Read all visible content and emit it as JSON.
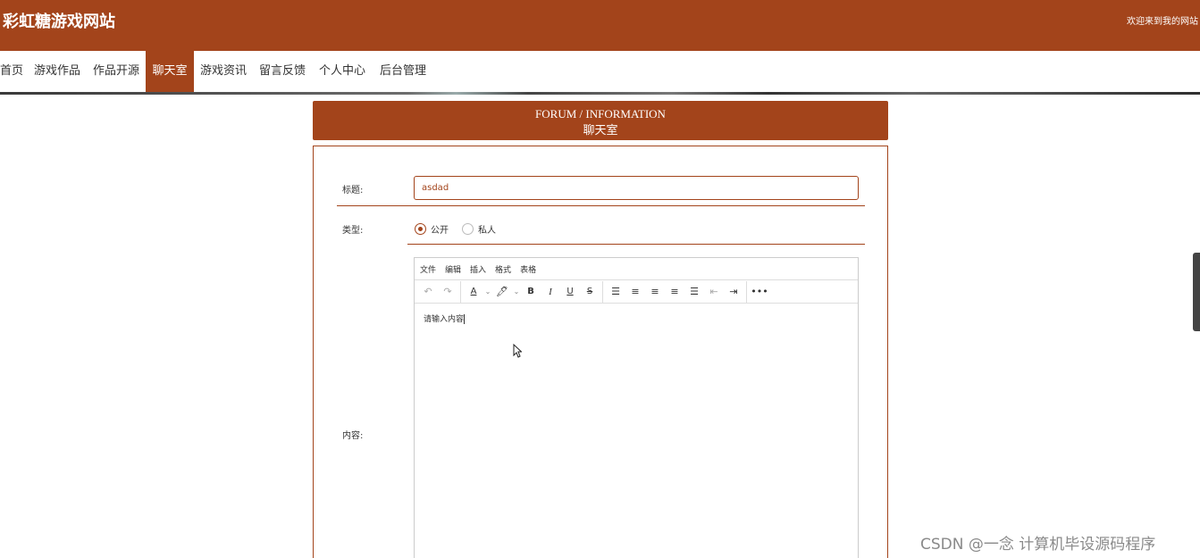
{
  "header": {
    "site_title": "彩虹糖游戏网站",
    "welcome": "欢迎来到我的网站"
  },
  "nav": {
    "items": [
      "首页",
      "游戏作品",
      "作品开源",
      "聊天室",
      "游戏资讯",
      "留言反馈",
      "个人中心",
      "后台管理"
    ],
    "active": "聊天室"
  },
  "section": {
    "title_en": "FORUM / INFORMATION",
    "title_cn": "聊天室"
  },
  "form": {
    "title_label": "标题:",
    "title_value": "asdad",
    "type_label": "类型:",
    "type_options": [
      "公开",
      "私人"
    ],
    "type_selected": "公开",
    "content_label": "内容:"
  },
  "editor": {
    "menu": [
      "文件",
      "编辑",
      "插入",
      "格式",
      "表格"
    ],
    "toolbar_icons": [
      "undo-icon",
      "redo-icon",
      "font-color-icon",
      "highlight-icon",
      "bold-icon",
      "italic-icon",
      "underline-icon",
      "strikethrough-icon",
      "list-icon",
      "align-left-icon",
      "align-center-icon",
      "align-right-icon",
      "justify-icon",
      "outdent-icon",
      "indent-icon",
      "more-icon"
    ],
    "content_text": "请输入内容"
  },
  "watermark": "CSDN @一念 计算机毕设源码程序",
  "colors": {
    "brand": "#a3441b"
  }
}
